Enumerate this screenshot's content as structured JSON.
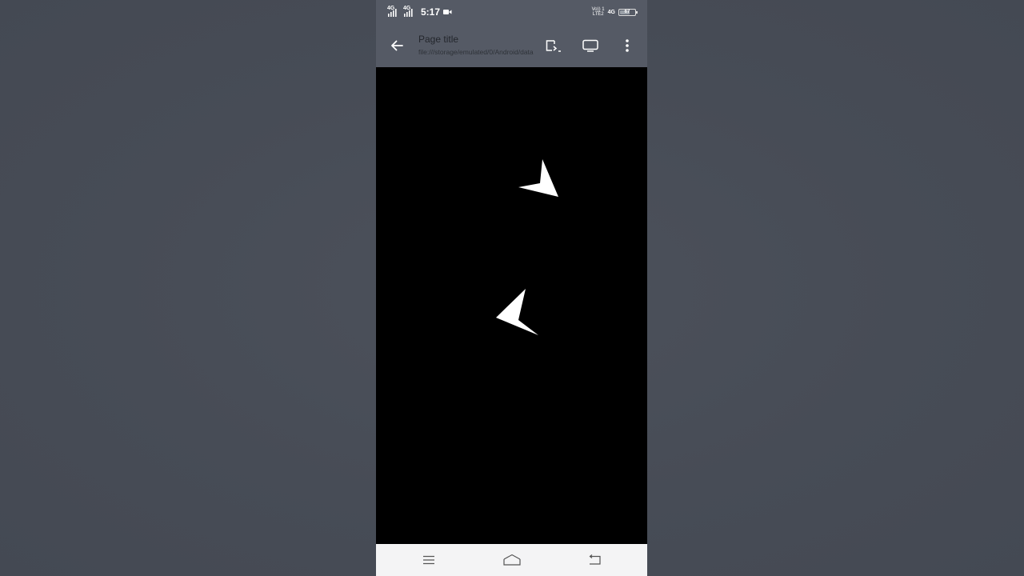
{
  "status_bar": {
    "sim1": "4G",
    "sim2": "4G",
    "time": "5:17",
    "volte_top": "Vo)) 1",
    "volte_bottom": "LTE2",
    "network": "4G",
    "battery": "67",
    "icons": [
      "signal-icon",
      "signal-icon",
      "video-record-icon",
      "battery-icon"
    ]
  },
  "toolbar": {
    "page_title": "Page title",
    "url": "file:///storage/emulated/0/Android/data",
    "icons": [
      "back-arrow-icon",
      "cast-icon",
      "screen-icon",
      "more-vert-icon"
    ]
  },
  "content": {
    "background": "#000000",
    "shapes": [
      "arrowhead",
      "arrowhead"
    ]
  },
  "nav_bar": {
    "icons": [
      "menu-icon",
      "home-icon",
      "back-icon"
    ]
  },
  "colors": {
    "bar": "#555a65",
    "backdrop": "#464b55",
    "nav": "#f4f4f5"
  }
}
